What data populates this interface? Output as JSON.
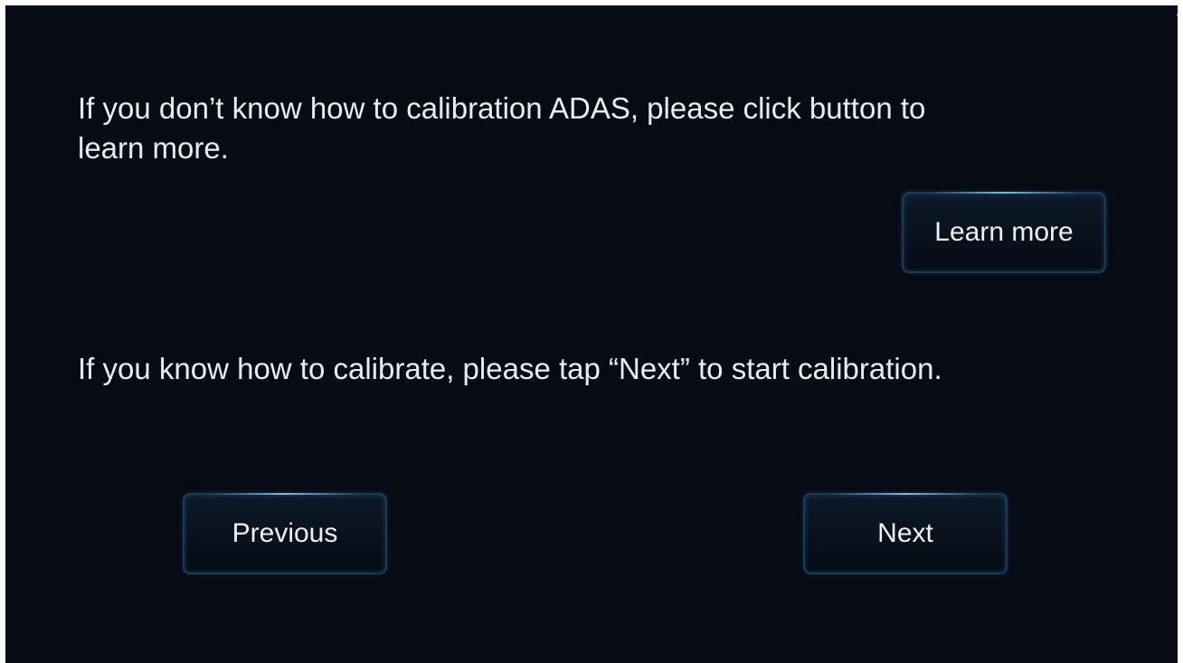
{
  "instructions": {
    "learn_text": "If you don’t know how to calibration ADAS, please click button to learn more.",
    "next_text": "If you know how to calibrate, please tap “Next” to start calibration."
  },
  "buttons": {
    "learn_more": "Learn more",
    "previous": "Previous",
    "next": "Next"
  },
  "colors": {
    "background": "#070b14",
    "text": "#e9ecf2",
    "button_border": "#1b3b55",
    "status_indicator": "#2fbf4f"
  }
}
